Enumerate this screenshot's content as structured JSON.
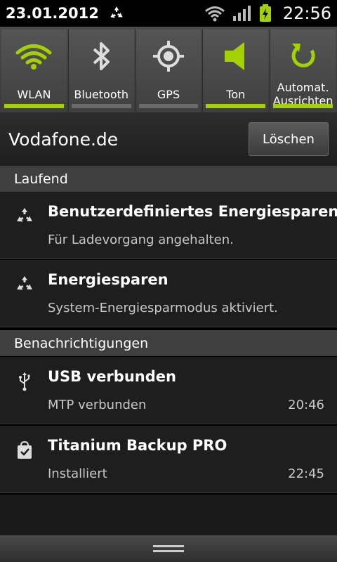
{
  "status_bar": {
    "date": "23.01.2012",
    "time": "22:56",
    "icons": [
      "recycle-icon",
      "wifi-icon",
      "signal-icon",
      "battery-charging-icon"
    ]
  },
  "quick_settings": {
    "tiles": [
      {
        "label": "WLAN",
        "icon": "wifi-icon",
        "active": true
      },
      {
        "label": "Bluetooth",
        "icon": "bluetooth-icon",
        "active": false
      },
      {
        "label": "GPS",
        "icon": "gps-icon",
        "active": false
      },
      {
        "label": "Ton",
        "icon": "speaker-icon",
        "active": true
      },
      {
        "label": "Automat.\nAusrichten",
        "label_line1": "Automat.",
        "label_line2": "Ausrichten",
        "icon": "rotate-icon",
        "active": true
      }
    ]
  },
  "operator": {
    "name": "Vodafone.de",
    "clear_label": "Löschen"
  },
  "sections": {
    "ongoing": "Laufend",
    "notifications": "Benachrichtigungen"
  },
  "ongoing_items": [
    {
      "title": "Benutzerdefiniertes Energiesparen",
      "text": "Für Ladevorgang angehalten.",
      "icon": "recycle-icon"
    },
    {
      "title": "Energiesparen",
      "text": "System-Energiesparmodus aktiviert.",
      "icon": "recycle-icon"
    }
  ],
  "notification_items": [
    {
      "title": "USB verbunden",
      "text": "MTP verbunden",
      "time": "20:46",
      "icon": "usb-icon"
    },
    {
      "title": "Titanium Backup PRO",
      "text": "Installiert",
      "time": "22:45",
      "icon": "install-bag-icon"
    }
  ],
  "colors": {
    "accent": "#a4d200",
    "inactive_bar": "#6a6a6a"
  }
}
